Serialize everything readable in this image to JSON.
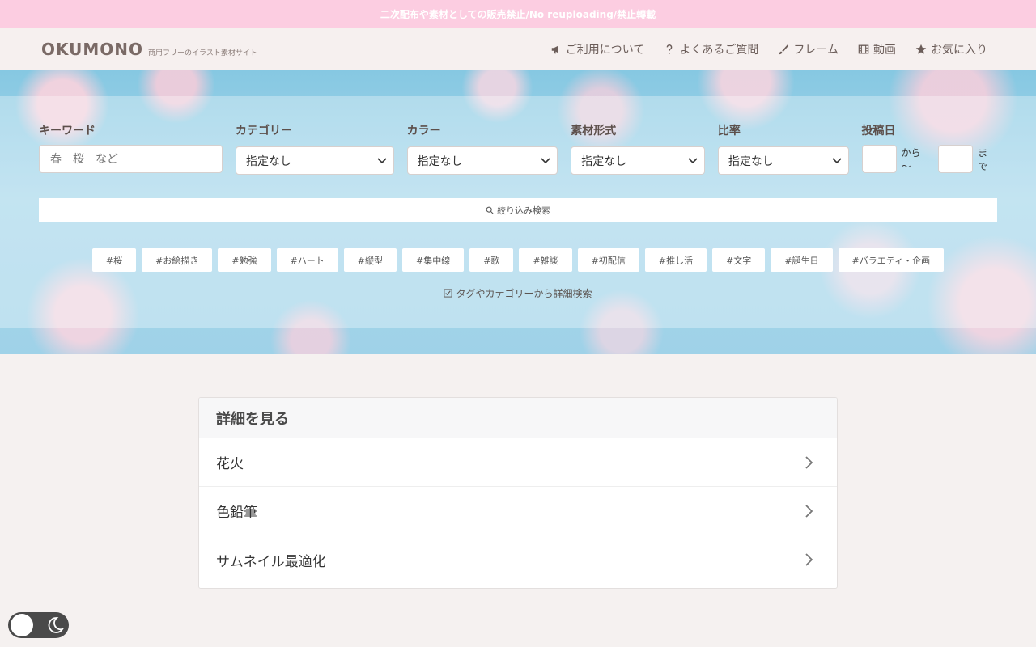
{
  "notice": {
    "text": "二次配布や素材としての販売禁止/No reuploading/禁止轉載"
  },
  "header": {
    "logo": "OKUMONO",
    "logo_sub": "商用フリーのイラスト素材サイト",
    "nav": [
      {
        "label": "ご利用について",
        "icon": "megaphone-icon"
      },
      {
        "label": "よくあるご質問",
        "icon": "question-icon"
      },
      {
        "label": "フレーム",
        "icon": "brush-icon"
      },
      {
        "label": "動画",
        "icon": "film-icon"
      },
      {
        "label": "お気に入り",
        "icon": "star-icon"
      }
    ]
  },
  "filters": {
    "keyword": {
      "label": "キーワード",
      "placeholder": "春　桜　など"
    },
    "category": {
      "label": "カテゴリー",
      "value": "指定なし"
    },
    "color": {
      "label": "カラー",
      "value": "指定なし"
    },
    "format": {
      "label": "素材形式",
      "value": "指定なし"
    },
    "ratio": {
      "label": "比率",
      "value": "指定なし"
    },
    "date": {
      "label": "投稿日",
      "from_text": "から 〜",
      "to_text": "まで"
    }
  },
  "search_button": "絞り込み検索",
  "tags": [
    "#桜",
    "#お絵描き",
    "#勉強",
    "#ハート",
    "#縦型",
    "#集中線",
    "#歌",
    "#雑談",
    "#初配信",
    "#推し活",
    "#文字",
    "#誕生日",
    "#バラエティ・企画"
  ],
  "advanced_search": "タグやカテゴリーから詳細検索",
  "details": {
    "title": "詳細を見る",
    "items": [
      "花火",
      "色鉛筆",
      "サムネイル最適化"
    ]
  },
  "colors": {
    "notice_bg": "#fccde1",
    "header_bg": "#f6f0ef",
    "page_bg": "#f5f1f0",
    "toggle_bg": "#4a4a4a"
  }
}
